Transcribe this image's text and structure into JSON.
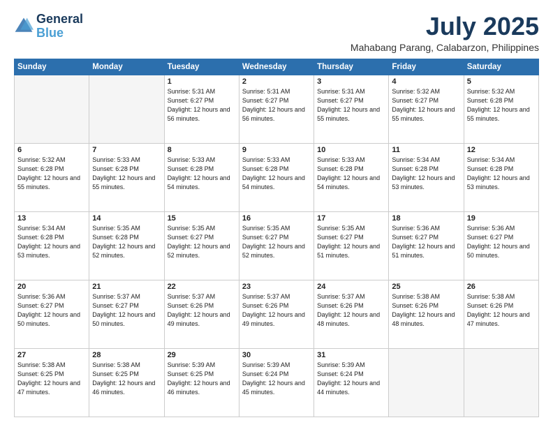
{
  "logo": {
    "line1": "General",
    "line2": "Blue"
  },
  "title": "July 2025",
  "location": "Mahabang Parang, Calabarzon, Philippines",
  "days_of_week": [
    "Sunday",
    "Monday",
    "Tuesday",
    "Wednesday",
    "Thursday",
    "Friday",
    "Saturday"
  ],
  "weeks": [
    [
      {
        "day": "",
        "info": ""
      },
      {
        "day": "",
        "info": ""
      },
      {
        "day": "1",
        "info": "Sunrise: 5:31 AM\nSunset: 6:27 PM\nDaylight: 12 hours and 56 minutes."
      },
      {
        "day": "2",
        "info": "Sunrise: 5:31 AM\nSunset: 6:27 PM\nDaylight: 12 hours and 56 minutes."
      },
      {
        "day": "3",
        "info": "Sunrise: 5:31 AM\nSunset: 6:27 PM\nDaylight: 12 hours and 55 minutes."
      },
      {
        "day": "4",
        "info": "Sunrise: 5:32 AM\nSunset: 6:27 PM\nDaylight: 12 hours and 55 minutes."
      },
      {
        "day": "5",
        "info": "Sunrise: 5:32 AM\nSunset: 6:28 PM\nDaylight: 12 hours and 55 minutes."
      }
    ],
    [
      {
        "day": "6",
        "info": "Sunrise: 5:32 AM\nSunset: 6:28 PM\nDaylight: 12 hours and 55 minutes."
      },
      {
        "day": "7",
        "info": "Sunrise: 5:33 AM\nSunset: 6:28 PM\nDaylight: 12 hours and 55 minutes."
      },
      {
        "day": "8",
        "info": "Sunrise: 5:33 AM\nSunset: 6:28 PM\nDaylight: 12 hours and 54 minutes."
      },
      {
        "day": "9",
        "info": "Sunrise: 5:33 AM\nSunset: 6:28 PM\nDaylight: 12 hours and 54 minutes."
      },
      {
        "day": "10",
        "info": "Sunrise: 5:33 AM\nSunset: 6:28 PM\nDaylight: 12 hours and 54 minutes."
      },
      {
        "day": "11",
        "info": "Sunrise: 5:34 AM\nSunset: 6:28 PM\nDaylight: 12 hours and 53 minutes."
      },
      {
        "day": "12",
        "info": "Sunrise: 5:34 AM\nSunset: 6:28 PM\nDaylight: 12 hours and 53 minutes."
      }
    ],
    [
      {
        "day": "13",
        "info": "Sunrise: 5:34 AM\nSunset: 6:28 PM\nDaylight: 12 hours and 53 minutes."
      },
      {
        "day": "14",
        "info": "Sunrise: 5:35 AM\nSunset: 6:28 PM\nDaylight: 12 hours and 52 minutes."
      },
      {
        "day": "15",
        "info": "Sunrise: 5:35 AM\nSunset: 6:27 PM\nDaylight: 12 hours and 52 minutes."
      },
      {
        "day": "16",
        "info": "Sunrise: 5:35 AM\nSunset: 6:27 PM\nDaylight: 12 hours and 52 minutes."
      },
      {
        "day": "17",
        "info": "Sunrise: 5:35 AM\nSunset: 6:27 PM\nDaylight: 12 hours and 51 minutes."
      },
      {
        "day": "18",
        "info": "Sunrise: 5:36 AM\nSunset: 6:27 PM\nDaylight: 12 hours and 51 minutes."
      },
      {
        "day": "19",
        "info": "Sunrise: 5:36 AM\nSunset: 6:27 PM\nDaylight: 12 hours and 50 minutes."
      }
    ],
    [
      {
        "day": "20",
        "info": "Sunrise: 5:36 AM\nSunset: 6:27 PM\nDaylight: 12 hours and 50 minutes."
      },
      {
        "day": "21",
        "info": "Sunrise: 5:37 AM\nSunset: 6:27 PM\nDaylight: 12 hours and 50 minutes."
      },
      {
        "day": "22",
        "info": "Sunrise: 5:37 AM\nSunset: 6:26 PM\nDaylight: 12 hours and 49 minutes."
      },
      {
        "day": "23",
        "info": "Sunrise: 5:37 AM\nSunset: 6:26 PM\nDaylight: 12 hours and 49 minutes."
      },
      {
        "day": "24",
        "info": "Sunrise: 5:37 AM\nSunset: 6:26 PM\nDaylight: 12 hours and 48 minutes."
      },
      {
        "day": "25",
        "info": "Sunrise: 5:38 AM\nSunset: 6:26 PM\nDaylight: 12 hours and 48 minutes."
      },
      {
        "day": "26",
        "info": "Sunrise: 5:38 AM\nSunset: 6:26 PM\nDaylight: 12 hours and 47 minutes."
      }
    ],
    [
      {
        "day": "27",
        "info": "Sunrise: 5:38 AM\nSunset: 6:25 PM\nDaylight: 12 hours and 47 minutes."
      },
      {
        "day": "28",
        "info": "Sunrise: 5:38 AM\nSunset: 6:25 PM\nDaylight: 12 hours and 46 minutes."
      },
      {
        "day": "29",
        "info": "Sunrise: 5:39 AM\nSunset: 6:25 PM\nDaylight: 12 hours and 46 minutes."
      },
      {
        "day": "30",
        "info": "Sunrise: 5:39 AM\nSunset: 6:24 PM\nDaylight: 12 hours and 45 minutes."
      },
      {
        "day": "31",
        "info": "Sunrise: 5:39 AM\nSunset: 6:24 PM\nDaylight: 12 hours and 44 minutes."
      },
      {
        "day": "",
        "info": ""
      },
      {
        "day": "",
        "info": ""
      }
    ]
  ]
}
